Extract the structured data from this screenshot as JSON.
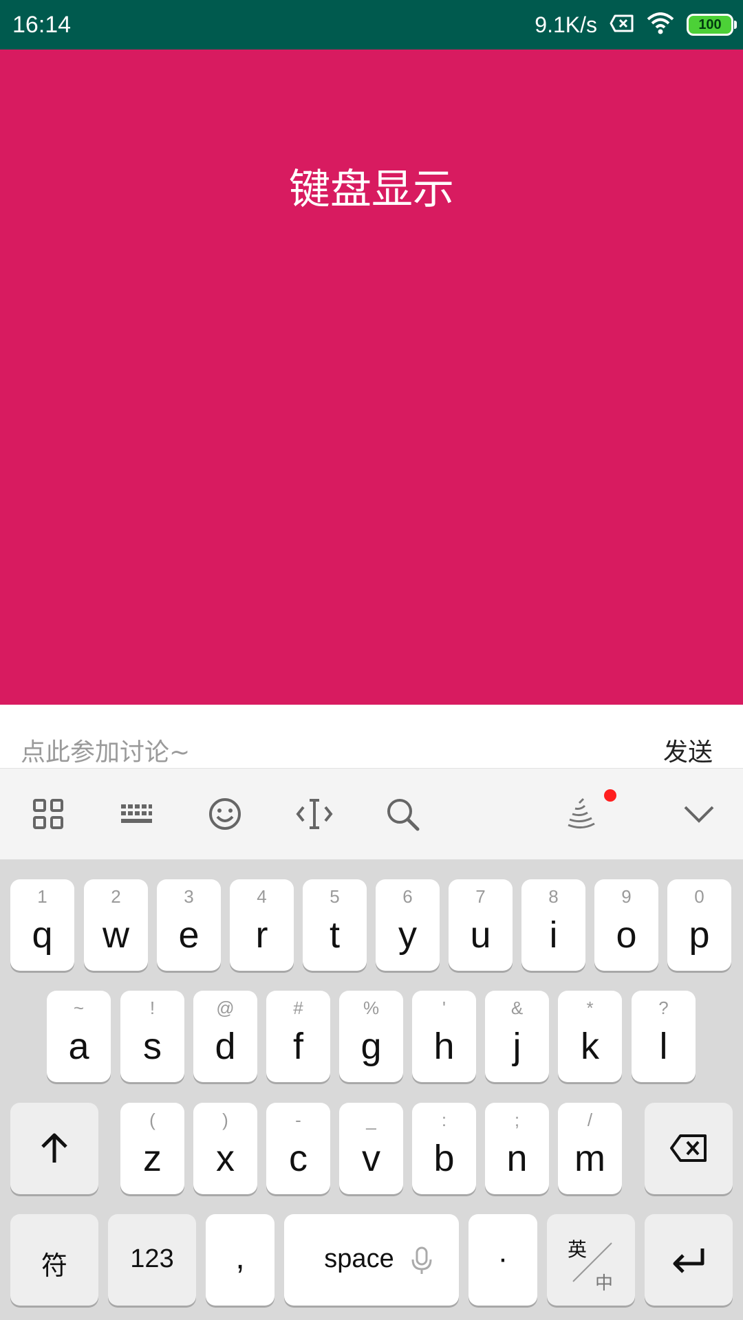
{
  "status_bar": {
    "time": "16:14",
    "speed": "9.1K/s",
    "battery": "100"
  },
  "main": {
    "title": "键盘显示",
    "background": "#d81b60"
  },
  "input_bar": {
    "placeholder": "点此参加讨论~",
    "send_label": "发送"
  },
  "keyboard": {
    "row1": [
      {
        "hint": "1",
        "char": "q"
      },
      {
        "hint": "2",
        "char": "w"
      },
      {
        "hint": "3",
        "char": "e"
      },
      {
        "hint": "4",
        "char": "r"
      },
      {
        "hint": "5",
        "char": "t"
      },
      {
        "hint": "6",
        "char": "y"
      },
      {
        "hint": "7",
        "char": "u"
      },
      {
        "hint": "8",
        "char": "i"
      },
      {
        "hint": "9",
        "char": "o"
      },
      {
        "hint": "0",
        "char": "p"
      }
    ],
    "row2": [
      {
        "hint": "~",
        "char": "a"
      },
      {
        "hint": "!",
        "char": "s"
      },
      {
        "hint": "@",
        "char": "d"
      },
      {
        "hint": "#",
        "char": "f"
      },
      {
        "hint": "%",
        "char": "g"
      },
      {
        "hint": "'",
        "char": "h"
      },
      {
        "hint": "&",
        "char": "j"
      },
      {
        "hint": "*",
        "char": "k"
      },
      {
        "hint": "?",
        "char": "l"
      }
    ],
    "row3": [
      {
        "hint": "(",
        "char": "z"
      },
      {
        "hint": ")",
        "char": "x"
      },
      {
        "hint": "-",
        "char": "c"
      },
      {
        "hint": "_",
        "char": "v"
      },
      {
        "hint": ":",
        "char": "b"
      },
      {
        "hint": ";",
        "char": "n"
      },
      {
        "hint": "/",
        "char": "m"
      }
    ],
    "symbols_label": "符",
    "numbers_label": "123",
    "comma_label": ",",
    "space_label": "space",
    "period_label": "·",
    "lang_top": "英",
    "lang_bottom": "中"
  }
}
